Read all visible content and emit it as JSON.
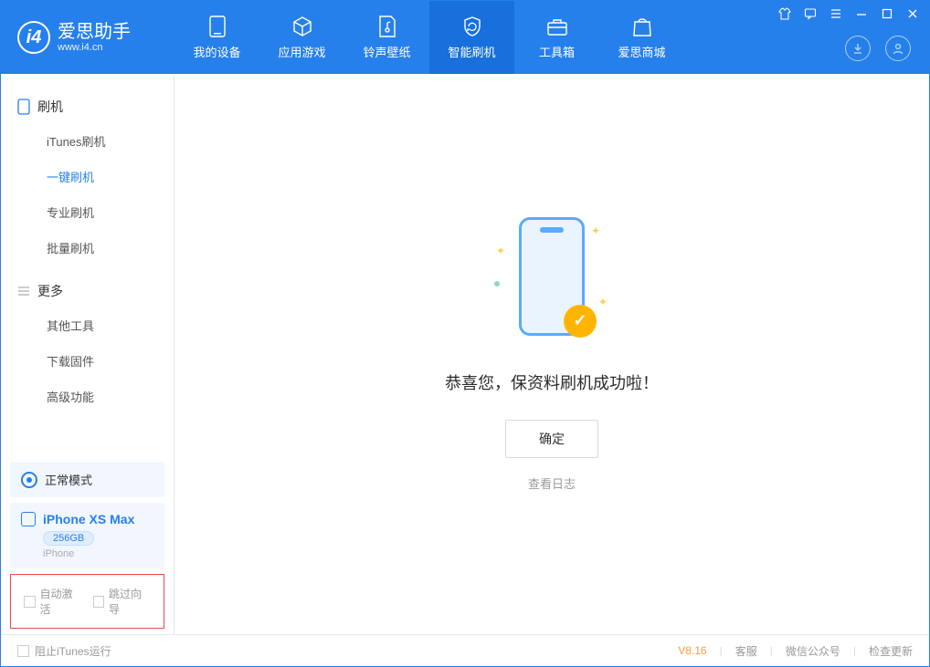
{
  "app": {
    "title": "爱思助手",
    "subtitle": "www.i4.cn"
  },
  "nav": {
    "items": [
      {
        "label": "我的设备"
      },
      {
        "label": "应用游戏"
      },
      {
        "label": "铃声壁纸"
      },
      {
        "label": "智能刷机"
      },
      {
        "label": "工具箱"
      },
      {
        "label": "爱思商城"
      }
    ]
  },
  "sidebar": {
    "section_flash": "刷机",
    "items_flash": [
      {
        "label": "iTunes刷机"
      },
      {
        "label": "一键刷机"
      },
      {
        "label": "专业刷机"
      },
      {
        "label": "批量刷机"
      }
    ],
    "section_more": "更多",
    "items_more": [
      {
        "label": "其他工具"
      },
      {
        "label": "下载固件"
      },
      {
        "label": "高级功能"
      }
    ],
    "status_mode": "正常模式",
    "device": {
      "name": "iPhone XS Max",
      "storage": "256GB",
      "type": "iPhone"
    },
    "checkboxes": {
      "auto_activate": "自动激活",
      "skip_guide": "跳过向导"
    }
  },
  "main": {
    "success_msg": "恭喜您，保资料刷机成功啦！",
    "ok_btn": "确定",
    "view_log": "查看日志"
  },
  "footer": {
    "block_itunes": "阻止iTunes运行",
    "version": "V8.16",
    "links": {
      "service": "客服",
      "wechat": "微信公众号",
      "update": "检查更新"
    }
  }
}
